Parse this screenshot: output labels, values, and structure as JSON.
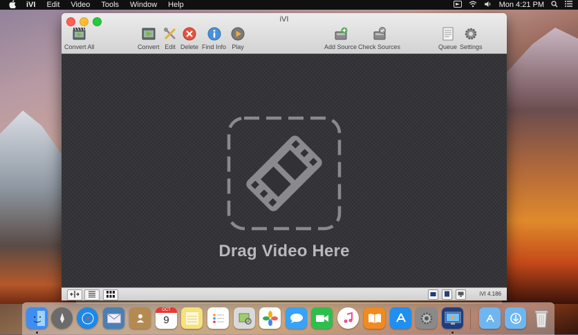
{
  "menubar": {
    "apple": "",
    "app_name": "iVI",
    "items": [
      "Edit",
      "Video",
      "Tools",
      "Window",
      "Help"
    ],
    "clock": "Mon 4:21 PM"
  },
  "window": {
    "title": "iVI",
    "toolbar": {
      "convert_all": "Convert All",
      "convert": "Convert",
      "edit": "Edit",
      "delete": "Delete",
      "find_info": "Find Info",
      "play": "Play",
      "add_source": "Add Source",
      "check_sources": "Check Sources",
      "queue": "Queue",
      "settings": "Settings"
    },
    "drop_text": "Drag Video Here",
    "version": "iVI 4.186"
  },
  "dock": {
    "apps": [
      {
        "name": "finder",
        "color": "#3d8df5"
      },
      {
        "name": "launchpad",
        "color": "#6b6b6b"
      },
      {
        "name": "safari",
        "color": "#1e88e5"
      },
      {
        "name": "mail",
        "color": "#4a7fb5"
      },
      {
        "name": "contacts",
        "color": "#b58a52"
      },
      {
        "name": "calendar",
        "color": "#ffffff",
        "text": "9",
        "month": "OCT"
      },
      {
        "name": "notes",
        "color": "#f7e27a"
      },
      {
        "name": "reminders",
        "color": "#ffffff"
      },
      {
        "name": "preview",
        "color": "#d9d9d9"
      },
      {
        "name": "photos",
        "color": "#ffffff"
      },
      {
        "name": "messages",
        "color": "#37a2f7"
      },
      {
        "name": "facetime",
        "color": "#2dbf4e"
      },
      {
        "name": "itunes",
        "color": "#f24f8a"
      },
      {
        "name": "ibooks",
        "color": "#f28a1e"
      },
      {
        "name": "app-store",
        "color": "#1f8ff0"
      },
      {
        "name": "system-preferences",
        "color": "#8a8a8a"
      },
      {
        "name": "ivi",
        "color": "#1b3f80"
      },
      {
        "name": "applications-folder",
        "color": "#6fb6f1"
      },
      {
        "name": "downloads-folder",
        "color": "#6fb6f1"
      },
      {
        "name": "trash",
        "color": "#d6d6d6"
      }
    ]
  }
}
